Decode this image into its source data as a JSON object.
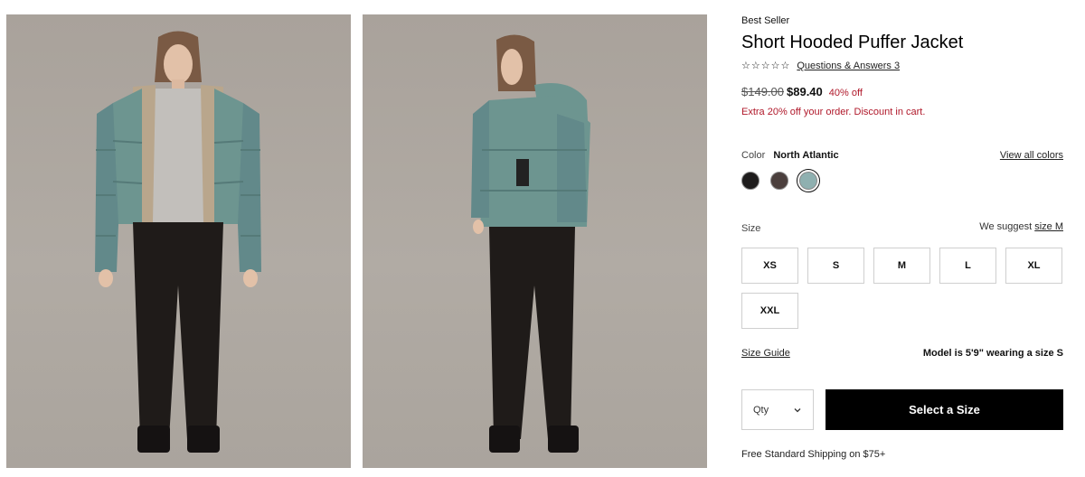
{
  "gallery": {
    "images": [
      {
        "alt": "Model wearing jacket, front view"
      },
      {
        "alt": "Model wearing jacket, back view"
      }
    ],
    "jacket_color": "#6d9590",
    "pants_color": "#1f1b19",
    "hoodie_color": "#c2bfbb"
  },
  "product": {
    "badge": "Best Seller",
    "title": "Short Hooded Puffer Jacket",
    "rating_stars": 5,
    "qa_link": "Questions & Answers 3",
    "original_price": "$149.00",
    "sale_price": "$89.40",
    "discount": "40% off",
    "promo": "Extra 20% off your order. Discount in cart."
  },
  "color": {
    "label": "Color",
    "selected": "North Atlantic",
    "view_all": "View all colors",
    "swatches": [
      {
        "name": "Black",
        "hex": "#1e1c1c"
      },
      {
        "name": "Brown",
        "hex": "#4b3f3d"
      },
      {
        "name": "North Atlantic",
        "hex": "#8fb0b0"
      }
    ]
  },
  "size": {
    "label": "Size",
    "suggest_prefix": "We suggest",
    "suggest_link": "size M",
    "options": [
      "XS",
      "S",
      "M",
      "L",
      "XL",
      "XXL"
    ]
  },
  "size_guide": "Size Guide",
  "model_info": "Model is 5'9\" wearing a size S",
  "qty": {
    "label": "Qty"
  },
  "cta": "Select a Size",
  "shipping": "Free Standard Shipping on $75+",
  "icons": {
    "star": "star-outline-icon",
    "chevron": "chevron-down-icon"
  }
}
